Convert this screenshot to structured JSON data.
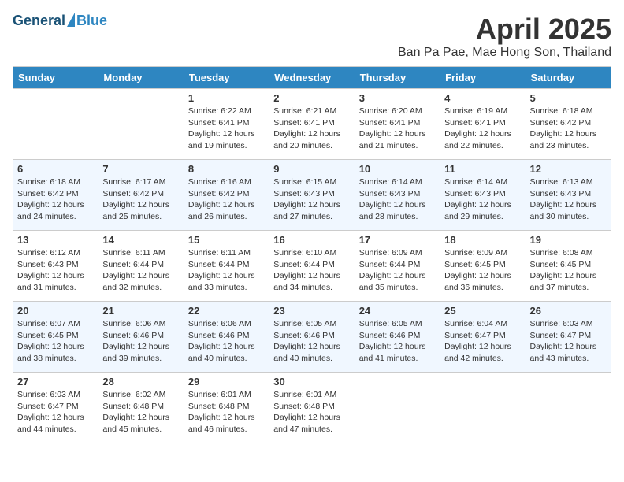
{
  "header": {
    "logo_general": "General",
    "logo_blue": "Blue",
    "month_title": "April 2025",
    "location": "Ban Pa Pae, Mae Hong Son, Thailand"
  },
  "weekdays": [
    "Sunday",
    "Monday",
    "Tuesday",
    "Wednesday",
    "Thursday",
    "Friday",
    "Saturday"
  ],
  "weeks": [
    [
      {
        "day": "",
        "sunrise": "",
        "sunset": "",
        "daylight": ""
      },
      {
        "day": "",
        "sunrise": "",
        "sunset": "",
        "daylight": ""
      },
      {
        "day": "1",
        "sunrise": "Sunrise: 6:22 AM",
        "sunset": "Sunset: 6:41 PM",
        "daylight": "Daylight: 12 hours and 19 minutes."
      },
      {
        "day": "2",
        "sunrise": "Sunrise: 6:21 AM",
        "sunset": "Sunset: 6:41 PM",
        "daylight": "Daylight: 12 hours and 20 minutes."
      },
      {
        "day": "3",
        "sunrise": "Sunrise: 6:20 AM",
        "sunset": "Sunset: 6:41 PM",
        "daylight": "Daylight: 12 hours and 21 minutes."
      },
      {
        "day": "4",
        "sunrise": "Sunrise: 6:19 AM",
        "sunset": "Sunset: 6:41 PM",
        "daylight": "Daylight: 12 hours and 22 minutes."
      },
      {
        "day": "5",
        "sunrise": "Sunrise: 6:18 AM",
        "sunset": "Sunset: 6:42 PM",
        "daylight": "Daylight: 12 hours and 23 minutes."
      }
    ],
    [
      {
        "day": "6",
        "sunrise": "Sunrise: 6:18 AM",
        "sunset": "Sunset: 6:42 PM",
        "daylight": "Daylight: 12 hours and 24 minutes."
      },
      {
        "day": "7",
        "sunrise": "Sunrise: 6:17 AM",
        "sunset": "Sunset: 6:42 PM",
        "daylight": "Daylight: 12 hours and 25 minutes."
      },
      {
        "day": "8",
        "sunrise": "Sunrise: 6:16 AM",
        "sunset": "Sunset: 6:42 PM",
        "daylight": "Daylight: 12 hours and 26 minutes."
      },
      {
        "day": "9",
        "sunrise": "Sunrise: 6:15 AM",
        "sunset": "Sunset: 6:43 PM",
        "daylight": "Daylight: 12 hours and 27 minutes."
      },
      {
        "day": "10",
        "sunrise": "Sunrise: 6:14 AM",
        "sunset": "Sunset: 6:43 PM",
        "daylight": "Daylight: 12 hours and 28 minutes."
      },
      {
        "day": "11",
        "sunrise": "Sunrise: 6:14 AM",
        "sunset": "Sunset: 6:43 PM",
        "daylight": "Daylight: 12 hours and 29 minutes."
      },
      {
        "day": "12",
        "sunrise": "Sunrise: 6:13 AM",
        "sunset": "Sunset: 6:43 PM",
        "daylight": "Daylight: 12 hours and 30 minutes."
      }
    ],
    [
      {
        "day": "13",
        "sunrise": "Sunrise: 6:12 AM",
        "sunset": "Sunset: 6:43 PM",
        "daylight": "Daylight: 12 hours and 31 minutes."
      },
      {
        "day": "14",
        "sunrise": "Sunrise: 6:11 AM",
        "sunset": "Sunset: 6:44 PM",
        "daylight": "Daylight: 12 hours and 32 minutes."
      },
      {
        "day": "15",
        "sunrise": "Sunrise: 6:11 AM",
        "sunset": "Sunset: 6:44 PM",
        "daylight": "Daylight: 12 hours and 33 minutes."
      },
      {
        "day": "16",
        "sunrise": "Sunrise: 6:10 AM",
        "sunset": "Sunset: 6:44 PM",
        "daylight": "Daylight: 12 hours and 34 minutes."
      },
      {
        "day": "17",
        "sunrise": "Sunrise: 6:09 AM",
        "sunset": "Sunset: 6:44 PM",
        "daylight": "Daylight: 12 hours and 35 minutes."
      },
      {
        "day": "18",
        "sunrise": "Sunrise: 6:09 AM",
        "sunset": "Sunset: 6:45 PM",
        "daylight": "Daylight: 12 hours and 36 minutes."
      },
      {
        "day": "19",
        "sunrise": "Sunrise: 6:08 AM",
        "sunset": "Sunset: 6:45 PM",
        "daylight": "Daylight: 12 hours and 37 minutes."
      }
    ],
    [
      {
        "day": "20",
        "sunrise": "Sunrise: 6:07 AM",
        "sunset": "Sunset: 6:45 PM",
        "daylight": "Daylight: 12 hours and 38 minutes."
      },
      {
        "day": "21",
        "sunrise": "Sunrise: 6:06 AM",
        "sunset": "Sunset: 6:46 PM",
        "daylight": "Daylight: 12 hours and 39 minutes."
      },
      {
        "day": "22",
        "sunrise": "Sunrise: 6:06 AM",
        "sunset": "Sunset: 6:46 PM",
        "daylight": "Daylight: 12 hours and 40 minutes."
      },
      {
        "day": "23",
        "sunrise": "Sunrise: 6:05 AM",
        "sunset": "Sunset: 6:46 PM",
        "daylight": "Daylight: 12 hours and 40 minutes."
      },
      {
        "day": "24",
        "sunrise": "Sunrise: 6:05 AM",
        "sunset": "Sunset: 6:46 PM",
        "daylight": "Daylight: 12 hours and 41 minutes."
      },
      {
        "day": "25",
        "sunrise": "Sunrise: 6:04 AM",
        "sunset": "Sunset: 6:47 PM",
        "daylight": "Daylight: 12 hours and 42 minutes."
      },
      {
        "day": "26",
        "sunrise": "Sunrise: 6:03 AM",
        "sunset": "Sunset: 6:47 PM",
        "daylight": "Daylight: 12 hours and 43 minutes."
      }
    ],
    [
      {
        "day": "27",
        "sunrise": "Sunrise: 6:03 AM",
        "sunset": "Sunset: 6:47 PM",
        "daylight": "Daylight: 12 hours and 44 minutes."
      },
      {
        "day": "28",
        "sunrise": "Sunrise: 6:02 AM",
        "sunset": "Sunset: 6:48 PM",
        "daylight": "Daylight: 12 hours and 45 minutes."
      },
      {
        "day": "29",
        "sunrise": "Sunrise: 6:01 AM",
        "sunset": "Sunset: 6:48 PM",
        "daylight": "Daylight: 12 hours and 46 minutes."
      },
      {
        "day": "30",
        "sunrise": "Sunrise: 6:01 AM",
        "sunset": "Sunset: 6:48 PM",
        "daylight": "Daylight: 12 hours and 47 minutes."
      },
      {
        "day": "",
        "sunrise": "",
        "sunset": "",
        "daylight": ""
      },
      {
        "day": "",
        "sunrise": "",
        "sunset": "",
        "daylight": ""
      },
      {
        "day": "",
        "sunrise": "",
        "sunset": "",
        "daylight": ""
      }
    ]
  ]
}
